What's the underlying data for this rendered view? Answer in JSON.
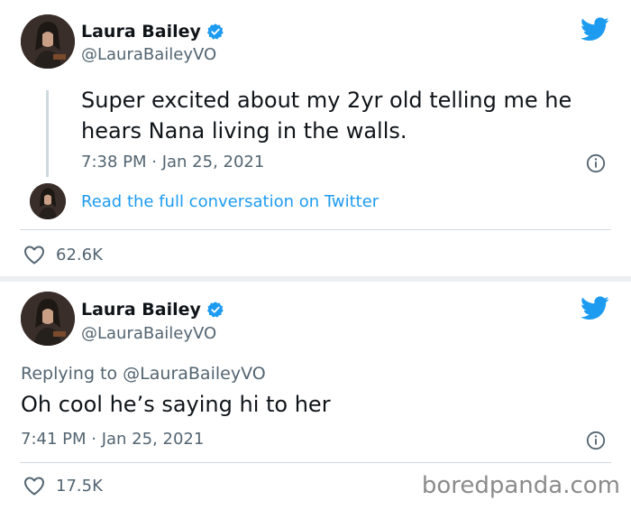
{
  "tweet1": {
    "author_name": "Laura Bailey",
    "author_handle": "@LauraBaileyVO",
    "text": "Super excited about my 2yr old telling me he hears Nana living in the walls.",
    "timestamp": "7:38 PM · Jan 25, 2021",
    "read_link": "Read the full conversation on Twitter",
    "likes": "62.6K"
  },
  "tweet2": {
    "author_name": "Laura Bailey",
    "author_handle": "@LauraBaileyVO",
    "replying_prefix": "Replying to",
    "replying_to": "@LauraBaileyVO",
    "text": "Oh cool he’s saying hi to her",
    "timestamp": "7:41 PM · Jan 25, 2021",
    "likes": "17.5K"
  },
  "watermark": "boredpanda.com",
  "colors": {
    "twitter_blue": "#1d9bf0",
    "text_primary": "#0f1419",
    "text_secondary": "#536471",
    "divider": "#cfd9de"
  },
  "icons": [
    "verified-badge-icon",
    "twitter-bird-icon",
    "info-icon",
    "heart-icon"
  ]
}
